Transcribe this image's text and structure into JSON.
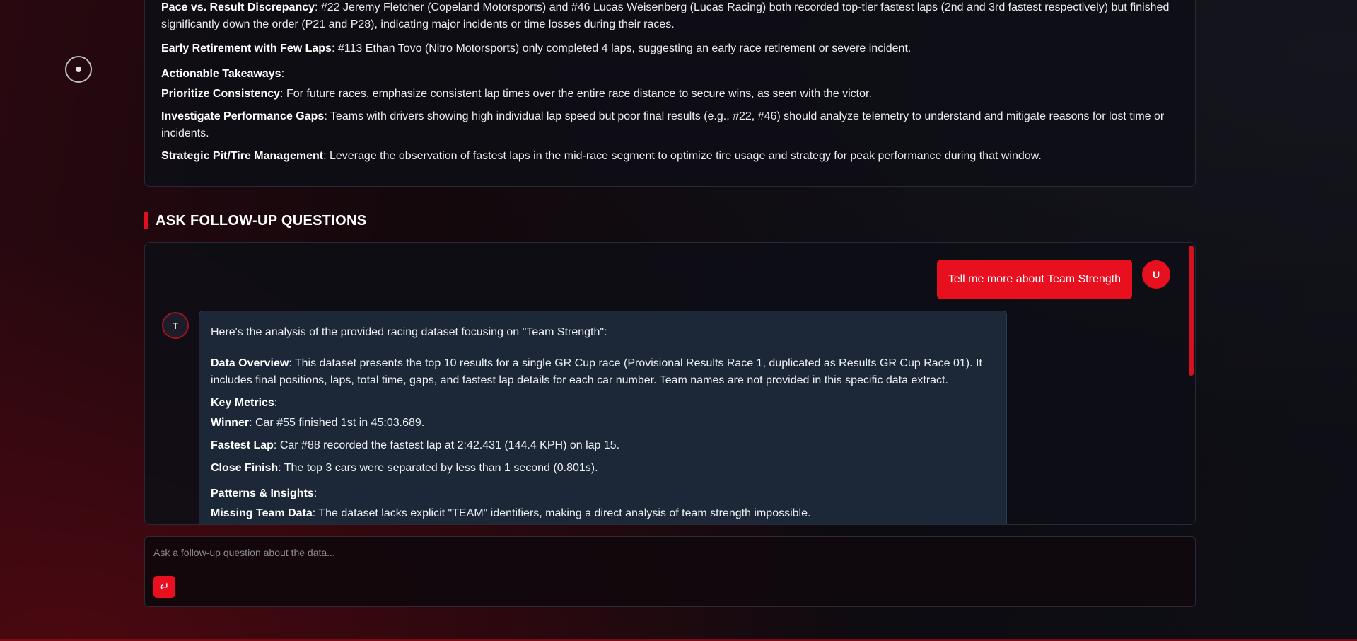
{
  "summary": {
    "items": [
      {
        "label": "Pace vs. Result Discrepancy",
        "text": ": #22 Jeremy Fletcher (Copeland Motorsports) and #46 Lucas Weisenberg (Lucas Racing) both recorded top-tier fastest laps (2nd and 3rd fastest respectively) but finished significantly down the order (P21 and P28), indicating major incidents or time losses during their races."
      },
      {
        "label": "Early Retirement with Few Laps",
        "text": ": #113 Ethan Tovo (Nitro Motorsports) only completed 4 laps, suggesting an early race retirement or severe incident."
      }
    ],
    "takeaways_heading": "Actionable Takeaways",
    "takeaways": [
      {
        "label": "Prioritize Consistency",
        "text": ": For future races, emphasize consistent lap times over the entire race distance to secure wins, as seen with the victor."
      },
      {
        "label": "Investigate Performance Gaps",
        "text": ": Teams with drivers showing high individual lap speed but poor final results (e.g., #22, #46) should analyze telemetry to understand and mitigate reasons for lost time or incidents."
      },
      {
        "label": "Strategic Pit/Tire Management",
        "text": ": Leverage the observation of fastest laps in the mid-race segment to optimize tire usage and strategy for peak performance during that window."
      }
    ]
  },
  "section": {
    "title": "ASK FOLLOW-UP QUESTIONS"
  },
  "chat": {
    "user_message": "Tell me more about Team Strength",
    "user_avatar": "U",
    "assistant_avatar": "T",
    "assistant": {
      "intro": "Here's the analysis of the provided racing dataset focusing on \"Team Strength\":",
      "overview_label": "Data Overview",
      "overview_text": ": This dataset presents the top 10 results for a single GR Cup race (Provisional Results Race 1, duplicated as Results GR Cup Race 01). It includes final positions, laps, total time, gaps, and fastest lap details for each car number. Team names are not provided in this specific data extract.",
      "key_metrics_heading": "Key Metrics",
      "metrics": [
        {
          "label": "Winner",
          "text": ": Car #55 finished 1st in 45:03.689."
        },
        {
          "label": "Fastest Lap",
          "text": ": Car #88 recorded the fastest lap at 2:42.431 (144.4 KPH) on lap 15."
        },
        {
          "label": "Close Finish",
          "text": ": The top 3 cars were separated by less than 1 second (0.801s)."
        }
      ],
      "patterns_heading": "Patterns & Insights",
      "patterns": [
        {
          "label": "Missing Team Data",
          "text": ": The dataset lacks explicit \"TEAM\" identifiers, making a direct analysis of team strength impossible."
        }
      ]
    }
  },
  "composer": {
    "placeholder": "Ask a follow-up question about the data...",
    "send_icon": "↵"
  },
  "colors": {
    "accent": "#e8101f",
    "assistant_bubble": "#1c2838",
    "panel": "#0e0e16"
  }
}
